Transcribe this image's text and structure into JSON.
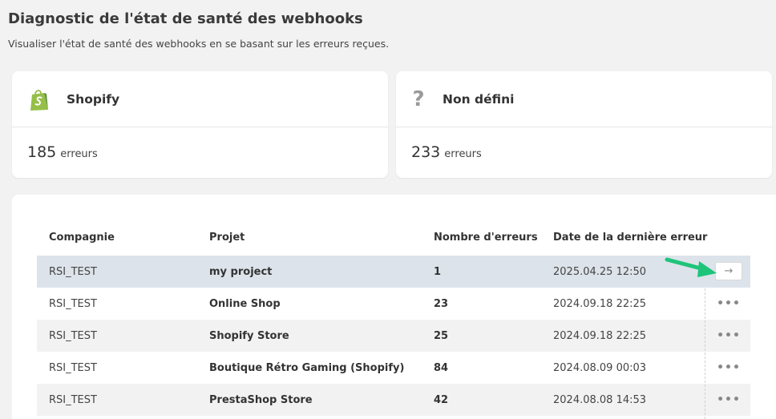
{
  "page": {
    "title": "Diagnostic de l'état de santé des webhooks",
    "subtitle": "Visualiser l'état de santé des webhooks en se basant sur les erreurs reçues."
  },
  "cards": [
    {
      "name": "Shopify",
      "icon": "shopify-bag-icon",
      "count": "185",
      "unit": "erreurs"
    },
    {
      "name": "Non défini",
      "icon": "question-mark-icon",
      "count": "233",
      "unit": "erreurs"
    }
  ],
  "table": {
    "headers": {
      "company": "Compagnie",
      "project": "Projet",
      "count": "Nombre d'erreurs",
      "date": "Date de la dernière erreur"
    },
    "rows": [
      {
        "company": "RSI_TEST",
        "project": "my project",
        "count": "1",
        "date": "2025.04.25 12:50",
        "action": "→"
      },
      {
        "company": "RSI_TEST",
        "project": "Online Shop",
        "count": "23",
        "date": "2024.09.18 22:25",
        "action": "•••"
      },
      {
        "company": "RSI_TEST",
        "project": "Shopify Store",
        "count": "25",
        "date": "2024.09.18 22:25",
        "action": "•••"
      },
      {
        "company": "RSI_TEST",
        "project": "Boutique Rétro Gaming (Shopify)",
        "count": "84",
        "date": "2024.08.09 00:03",
        "action": "•••"
      },
      {
        "company": "RSI_TEST",
        "project": "PrestaShop Store",
        "count": "42",
        "date": "2024.08.08 14:53",
        "action": "•••"
      }
    ]
  },
  "colors": {
    "shopify_green": "#95bf47",
    "selected_row": "#dde3ea",
    "annotation_arrow": "#1ec47a"
  }
}
